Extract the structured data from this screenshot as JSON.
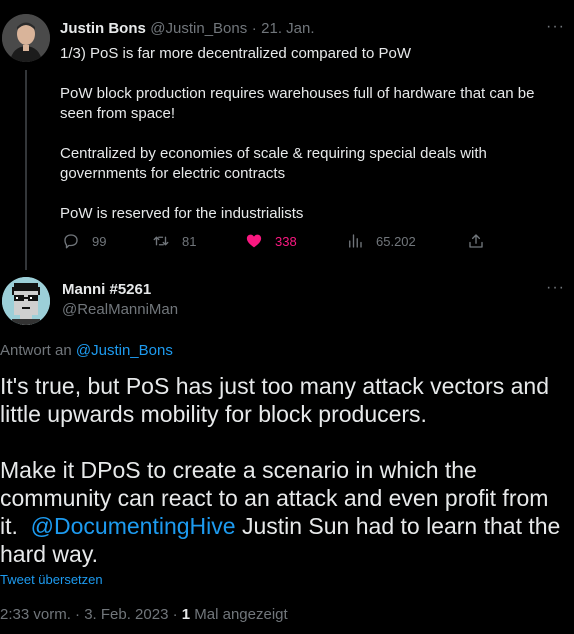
{
  "tweet1": {
    "author_name": "Justin Bons",
    "handle": "@Justin_Bons",
    "separator": "·",
    "date": "21. Jan.",
    "paragraphs": [
      "1/3) PoS is far more decentralized compared to PoW",
      "PoW block production requires warehouses full of hardware that can be seen from space!",
      "Centralized by economies of scale & requiring special deals with governments for electric contracts",
      "PoW is reserved for the industrialists"
    ],
    "replies": "99",
    "retweets": "81",
    "likes": "338",
    "views": "65.202",
    "more": "···"
  },
  "tweet2": {
    "author_name": "Manni #5261",
    "handle": "@RealManniMan",
    "more": "···",
    "reply_prefix": "Antwort an",
    "reply_to": "@Justin_Bons",
    "paragraph1": "It's true, but PoS has just too many attack vectors and little upwards mobility for block producers.",
    "paragraph2_a": "Make it DPoS to create a scenario in which the community can react to an attack and even profit from it.",
    "mention": "@DocumentingHive",
    "paragraph2_b": "Justin Sun had to learn that the hard way.",
    "translate": "Tweet übersetzen",
    "timestamp": "2:33 vorm. · 3. Feb. 2023 ·",
    "view_count": "1",
    "view_label": "Mal angezeigt"
  },
  "colors": {
    "background": "#000000",
    "text": "#e7e9ea",
    "muted": "#71767b",
    "link": "#1d9bf0",
    "like": "#f91880"
  },
  "icons": {
    "reply": "reply-icon",
    "retweet": "retweet-icon",
    "like": "heart-icon",
    "views": "views-icon",
    "share": "share-icon"
  }
}
